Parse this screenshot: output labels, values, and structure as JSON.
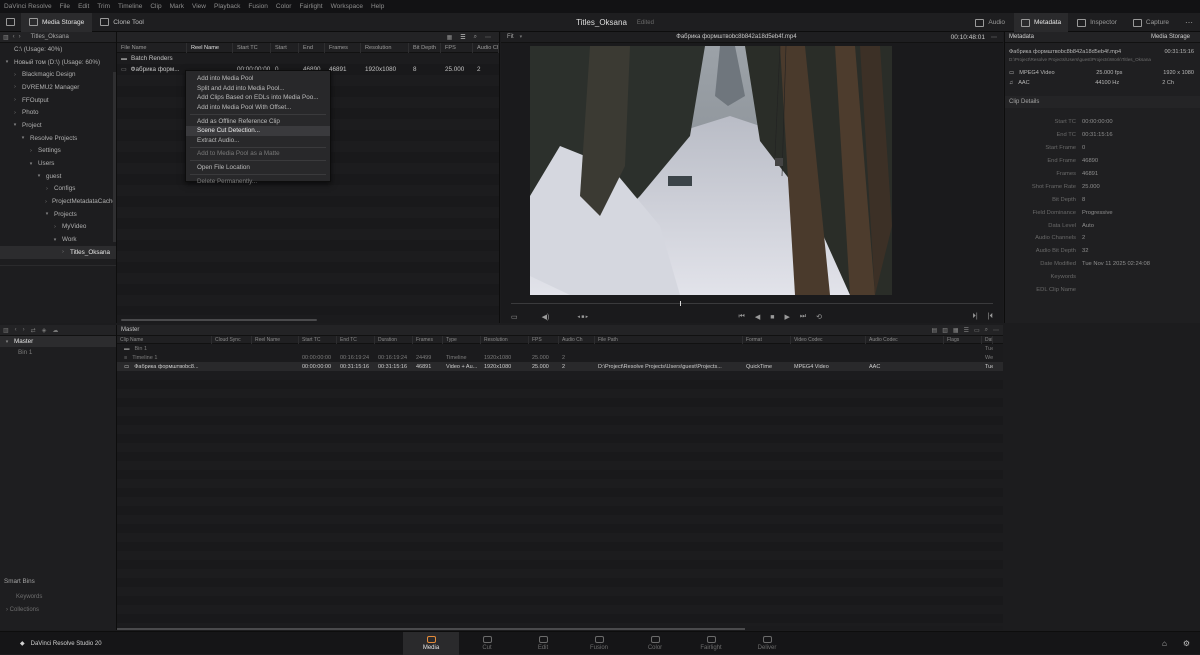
{
  "menubar": [
    "DaVinci Resolve",
    "File",
    "Edit",
    "Trim",
    "Timeline",
    "Clip",
    "Mark",
    "View",
    "Playback",
    "Fusion",
    "Color",
    "Fairlight",
    "Workspace",
    "Help"
  ],
  "tabs": {
    "media_storage": "Media Storage",
    "clone_tool": "Clone Tool"
  },
  "project": {
    "title": "Titles_Oksana",
    "status": "Edited"
  },
  "right_tabs": {
    "audio": "Audio",
    "metadata": "Metadata",
    "inspector": "Inspector",
    "capture": "Capture"
  },
  "storage": {
    "path": "Titles_Oksana",
    "items": [
      {
        "label": "C:\\ (Usage: 40%)",
        "level": 0,
        "caret": ""
      },
      {
        "label": "Новый том (D:\\) (Usage: 60%)",
        "level": 0,
        "caret": "▾"
      },
      {
        "label": "Blackmagic Design",
        "level": 1,
        "caret": "›"
      },
      {
        "label": "DVREMU2 Manager",
        "level": 1,
        "caret": "›"
      },
      {
        "label": "FFOutput",
        "level": 1,
        "caret": "›"
      },
      {
        "label": "Photo",
        "level": 1,
        "caret": "›"
      },
      {
        "label": "Project",
        "level": 1,
        "caret": "▾"
      },
      {
        "label": "Resolve Projects",
        "level": 2,
        "caret": "▾"
      },
      {
        "label": "Settings",
        "level": 3,
        "caret": "›"
      },
      {
        "label": "Users",
        "level": 3,
        "caret": "▾"
      },
      {
        "label": "guest",
        "level": 4,
        "caret": "▾"
      },
      {
        "label": "Configs",
        "level": 5,
        "caret": "›"
      },
      {
        "label": "ProjectMetadataCache",
        "level": 5,
        "caret": "›"
      },
      {
        "label": "Projects",
        "level": 5,
        "caret": "▾"
      },
      {
        "label": "MyVideo",
        "level": 6,
        "caret": "›"
      },
      {
        "label": "Work",
        "level": 6,
        "caret": "▾"
      },
      {
        "label": "Titles_Oksana",
        "level": 7,
        "caret": "›"
      }
    ]
  },
  "filelist": {
    "columns": [
      "File Name",
      "Reel Name",
      "Start TC",
      "Start",
      "End",
      "Frames",
      "Resolution",
      "Bit Depth",
      "FPS",
      "Audio Ch"
    ],
    "rows": [
      {
        "name": "Batch Renders",
        "reel": "",
        "start_tc": "",
        "start": "",
        "end": "",
        "frames": "",
        "res": "",
        "bit": "",
        "fps": "",
        "ach": "",
        "folder": true
      },
      {
        "name": "Фабрика форм...",
        "reel": "",
        "start_tc": "00:00:00:00",
        "start": "0",
        "end": "46890",
        "frames": "46891",
        "res": "1920x1080",
        "bit": "8",
        "fps": "25.000",
        "ach": "2",
        "folder": false
      }
    ]
  },
  "context_menu": [
    {
      "label": "Add into Media Pool",
      "state": "normal"
    },
    {
      "label": "Split and Add into Media Pool...",
      "state": "normal"
    },
    {
      "label": "Add Clips Based on EDLs into Media Poo...",
      "state": "normal"
    },
    {
      "label": "Add into Media Pool With Offset...",
      "state": "normal"
    },
    {
      "sep": true
    },
    {
      "label": "Add as Offline Reference Clip",
      "state": "normal"
    },
    {
      "label": "Scene Cut Detection...",
      "state": "highlight"
    },
    {
      "label": "Extract Audio...",
      "state": "normal"
    },
    {
      "sep": true
    },
    {
      "label": "Add to Media Pool as a Matte",
      "state": "dim"
    },
    {
      "sep": true
    },
    {
      "label": "Open File Location",
      "state": "normal"
    },
    {
      "sep": true
    },
    {
      "label": "Delete Permanently...",
      "state": "dim"
    }
  ],
  "viewer": {
    "fit": "Fit",
    "clip_name": "Фабрика формштвоbc8b842a18d5eb4f.mp4",
    "timecode": "00:10:48:01",
    "playhead": 0.35
  },
  "inspector": {
    "header_left": "Metadata",
    "header_right": "Media Storage",
    "file_name": "Фабрика формштвоbc8b842a18d5eb4f.mp4",
    "file_duration": "00:31:15:16",
    "file_path": "D:\\Project\\Resolve Projects\\Users\\guest\\Projects\\Work\\Titles_Oksana",
    "video": {
      "codec": "MPEG4 Video",
      "fps": "25.000 fps",
      "res": "1920 x 1080"
    },
    "audio": {
      "codec": "AAC",
      "hz": "44100 Hz",
      "ch": "2 Ch"
    },
    "details_title": "Clip Details",
    "details": [
      {
        "k": "Start TC",
        "v": "00:00:00:00"
      },
      {
        "k": "End TC",
        "v": "00:31:15:16"
      },
      {
        "k": "Start Frame",
        "v": "0"
      },
      {
        "k": "End Frame",
        "v": "46890"
      },
      {
        "k": "Frames",
        "v": "46891"
      },
      {
        "k": "Shot Frame Rate",
        "v": "25.000"
      },
      {
        "k": "Bit Depth",
        "v": "8"
      },
      {
        "k": "Field Dominance",
        "v": "Progressive"
      },
      {
        "k": "Data Level",
        "v": "Auto"
      },
      {
        "k": "Audio Channels",
        "v": "2"
      },
      {
        "k": "Audio Bit Depth",
        "v": "32"
      },
      {
        "k": "Date Modified",
        "v": "Tue Nov 11 2025 02:24:08"
      },
      {
        "k": "Keywords",
        "v": ""
      },
      {
        "k": "EDL Clip Name",
        "v": ""
      }
    ]
  },
  "bins": {
    "master": "Master",
    "bin1": "Bin 1",
    "smart_bins": "Smart Bins",
    "keywords": "Keywords",
    "collections": "Collections"
  },
  "pool": {
    "title": "Master",
    "columns": [
      "Clip Name",
      "Cloud Sync",
      "Reel Name",
      "Start TC",
      "End TC",
      "Duration",
      "Frames",
      "Type",
      "Resolution",
      "FPS",
      "Audio Ch",
      "File Path",
      "Format",
      "Video Codec",
      "Audio Codec",
      "Flags",
      "Date"
    ],
    "rows": [
      {
        "cells": [
          "Bin 1",
          "",
          "",
          "",
          "",
          "",
          "",
          "",
          "",
          "",
          "",
          "",
          "",
          "",
          "",
          "",
          "Tue"
        ],
        "kind": "bin"
      },
      {
        "cells": [
          "Timeline 1",
          "",
          "",
          "00:00:00:00",
          "00:16:19:24",
          "00:16:19:24",
          "24499",
          "Timeline",
          "1920x1080",
          "25.000",
          "2",
          "",
          "",
          "",
          "",
          "",
          "Wed"
        ],
        "kind": "timeline"
      },
      {
        "cells": [
          "Фабрика формштвоbc8...",
          "",
          "",
          "00:00:00:00",
          "00:31:15:16",
          "00:31:15:16",
          "46891",
          "Video + Au...",
          "1920x1080",
          "25.000",
          "2",
          "D:\\Project\\Resolve Projects\\Users\\guest\\Projects...",
          "QuickTime",
          "MPEG4 Video",
          "AAC",
          "",
          "Tue"
        ],
        "kind": "clip"
      }
    ]
  },
  "app_name": "DaVinci Resolve Studio 20",
  "pages": [
    "Media",
    "Cut",
    "Edit",
    "Fusion",
    "Color",
    "Fairlight",
    "Deliver"
  ],
  "active_page": "Media",
  "accent": "#e58b3a"
}
